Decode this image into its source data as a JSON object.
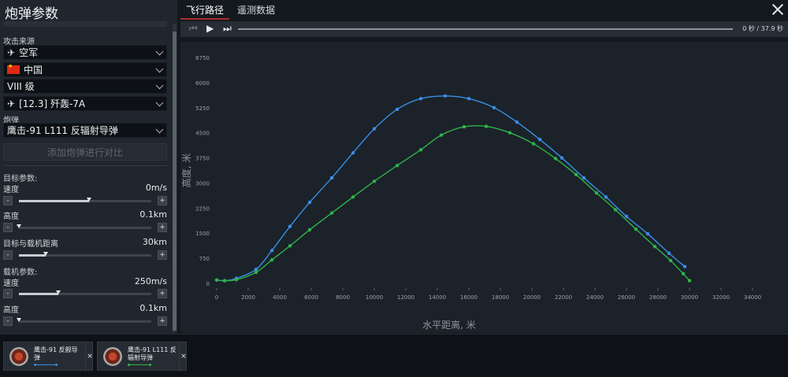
{
  "panel": {
    "title": "炮弹参数",
    "source_label": "攻击来源",
    "source": {
      "branch": "空军",
      "country": "中国",
      "tier": "VIII 级",
      "vehicle": "[12.3] 歼轰-7A"
    },
    "shell_label": "炮弹",
    "shell": "鹰击-91 L111 反辐射导弹",
    "compare_button": "添加炮弹进行对比",
    "target_params_label": "目标参数:",
    "carrier_params_label": "载机参数:",
    "params": [
      {
        "label": "速度",
        "value": "0m/s",
        "level": 0.53
      },
      {
        "label": "高度",
        "value": "0.1km",
        "level": 0.0
      },
      {
        "label": "目标与载机距离",
        "value": "30km",
        "level": 0.2
      },
      {
        "label": "速度",
        "value": "250m/s",
        "level": 0.3
      },
      {
        "label": "高度",
        "value": "0.1km",
        "level": 0.0
      }
    ],
    "minus": "-",
    "plus": "+"
  },
  "tabs": [
    {
      "label": "飞行路径",
      "active": true
    },
    {
      "label": "遥测数据",
      "active": false
    }
  ],
  "player": {
    "prev_icon": "skip-back-icon",
    "play_icon": "play-icon",
    "next_icon": "skip-forward-icon",
    "time": "0 秒 / 37.9 秒"
  },
  "chart_data": {
    "type": "line",
    "xlabel": "水平距离, 米",
    "ylabel": "高度, 米",
    "xlim": [
      0,
      34000
    ],
    "ylim": [
      0,
      6750
    ],
    "xticks": [
      0,
      2000,
      4000,
      6000,
      8000,
      10000,
      12000,
      14000,
      16000,
      18000,
      20000,
      22000,
      24000,
      26000,
      28000,
      30000,
      32000,
      34000
    ],
    "yticks": [
      0,
      750,
      1500,
      2250,
      3000,
      3750,
      4500,
      5250,
      6000,
      6750
    ],
    "series": [
      {
        "color": "#3a8ee6",
        "x": [
          0,
          500,
          1250,
          2500,
          3500,
          4650,
          5900,
          7300,
          8650,
          10000,
          11450,
          12950,
          14500,
          16000,
          17600,
          19050,
          20500,
          21900,
          23300,
          24700,
          26000,
          27350,
          28700,
          29700
        ],
        "y": [
          100,
          80,
          150,
          420,
          980,
          1700,
          2420,
          3150,
          3900,
          4620,
          5200,
          5520,
          5600,
          5520,
          5250,
          4820,
          4300,
          3750,
          3150,
          2580,
          2000,
          1480,
          900,
          500
        ]
      },
      {
        "color": "#2fb34a",
        "x": [
          0,
          500,
          1250,
          2500,
          3500,
          4650,
          5900,
          7300,
          8650,
          10000,
          11450,
          12950,
          14250,
          15700,
          17100,
          18600,
          20100,
          21500,
          22800,
          24100,
          25300,
          26600,
          27800,
          28800,
          29600,
          30000
        ],
        "y": [
          100,
          80,
          110,
          330,
          700,
          1120,
          1600,
          2100,
          2580,
          3050,
          3520,
          3990,
          4430,
          4680,
          4690,
          4500,
          4170,
          3730,
          3250,
          2700,
          2200,
          1620,
          1100,
          680,
          290,
          80
        ]
      }
    ]
  },
  "compare_cards": [
    {
      "name": "鹰击-91 反舰导弹",
      "color": "#3a8ee6",
      "close": "×"
    },
    {
      "name": "鹰击-91 L111 反辐射导弹",
      "color": "#2fb34a",
      "close": "×"
    }
  ]
}
